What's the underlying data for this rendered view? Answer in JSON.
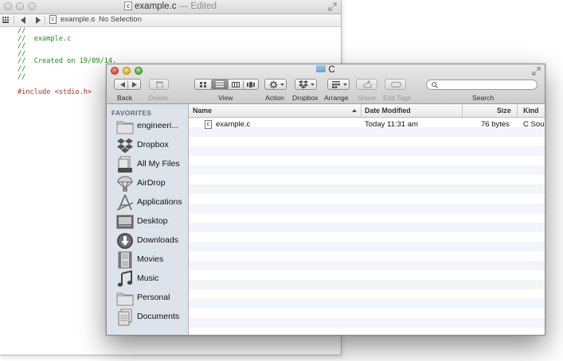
{
  "editor": {
    "title_file": "example.c",
    "title_suffix": "— Edited",
    "file_badge": "c",
    "jumpbar": {
      "file": "example.c",
      "separator": "›",
      "selection": "No Selection"
    },
    "code_lines": [
      {
        "kind": "comment",
        "text": "//"
      },
      {
        "kind": "comment",
        "text": "//  example.c"
      },
      {
        "kind": "comment",
        "text": "//"
      },
      {
        "kind": "comment",
        "text": "//"
      },
      {
        "kind": "comment",
        "text": "//  Created on 19/09/14."
      },
      {
        "kind": "comment",
        "text": "//"
      },
      {
        "kind": "comment",
        "text": "//"
      },
      {
        "kind": "blank",
        "text": ""
      },
      {
        "kind": "include",
        "text": "#include <stdio.h>"
      }
    ]
  },
  "finder": {
    "title": "C",
    "toolbar": {
      "back": "Back",
      "delete": "Delete",
      "view": "View",
      "action": "Action",
      "dropbox": "Dropbox",
      "arrange": "Arrange",
      "share": "Share",
      "edit_tags": "Edit Tags",
      "search": "Search"
    },
    "sidebar": {
      "heading": "FAVORITES",
      "items": [
        {
          "label": "engineeri...",
          "icon": "folder-icon"
        },
        {
          "label": "Dropbox",
          "icon": "dropbox-icon"
        },
        {
          "label": "All My Files",
          "icon": "all-my-files-icon"
        },
        {
          "label": "AirDrop",
          "icon": "airdrop-icon"
        },
        {
          "label": "Applications",
          "icon": "applications-icon"
        },
        {
          "label": "Desktop",
          "icon": "desktop-icon"
        },
        {
          "label": "Downloads",
          "icon": "downloads-icon"
        },
        {
          "label": "Movies",
          "icon": "movies-icon"
        },
        {
          "label": "Music",
          "icon": "music-icon"
        },
        {
          "label": "Personal",
          "icon": "folder-icon"
        },
        {
          "label": "Documents",
          "icon": "documents-icon"
        }
      ]
    },
    "list": {
      "columns": {
        "name": "Name",
        "date": "Date Modified",
        "size": "Size",
        "kind": "Kind"
      },
      "rows": [
        {
          "badge": "c",
          "name": "example.c",
          "date": "Today 11:31 am",
          "size": "76 bytes",
          "kind": "C Sou"
        }
      ]
    }
  }
}
